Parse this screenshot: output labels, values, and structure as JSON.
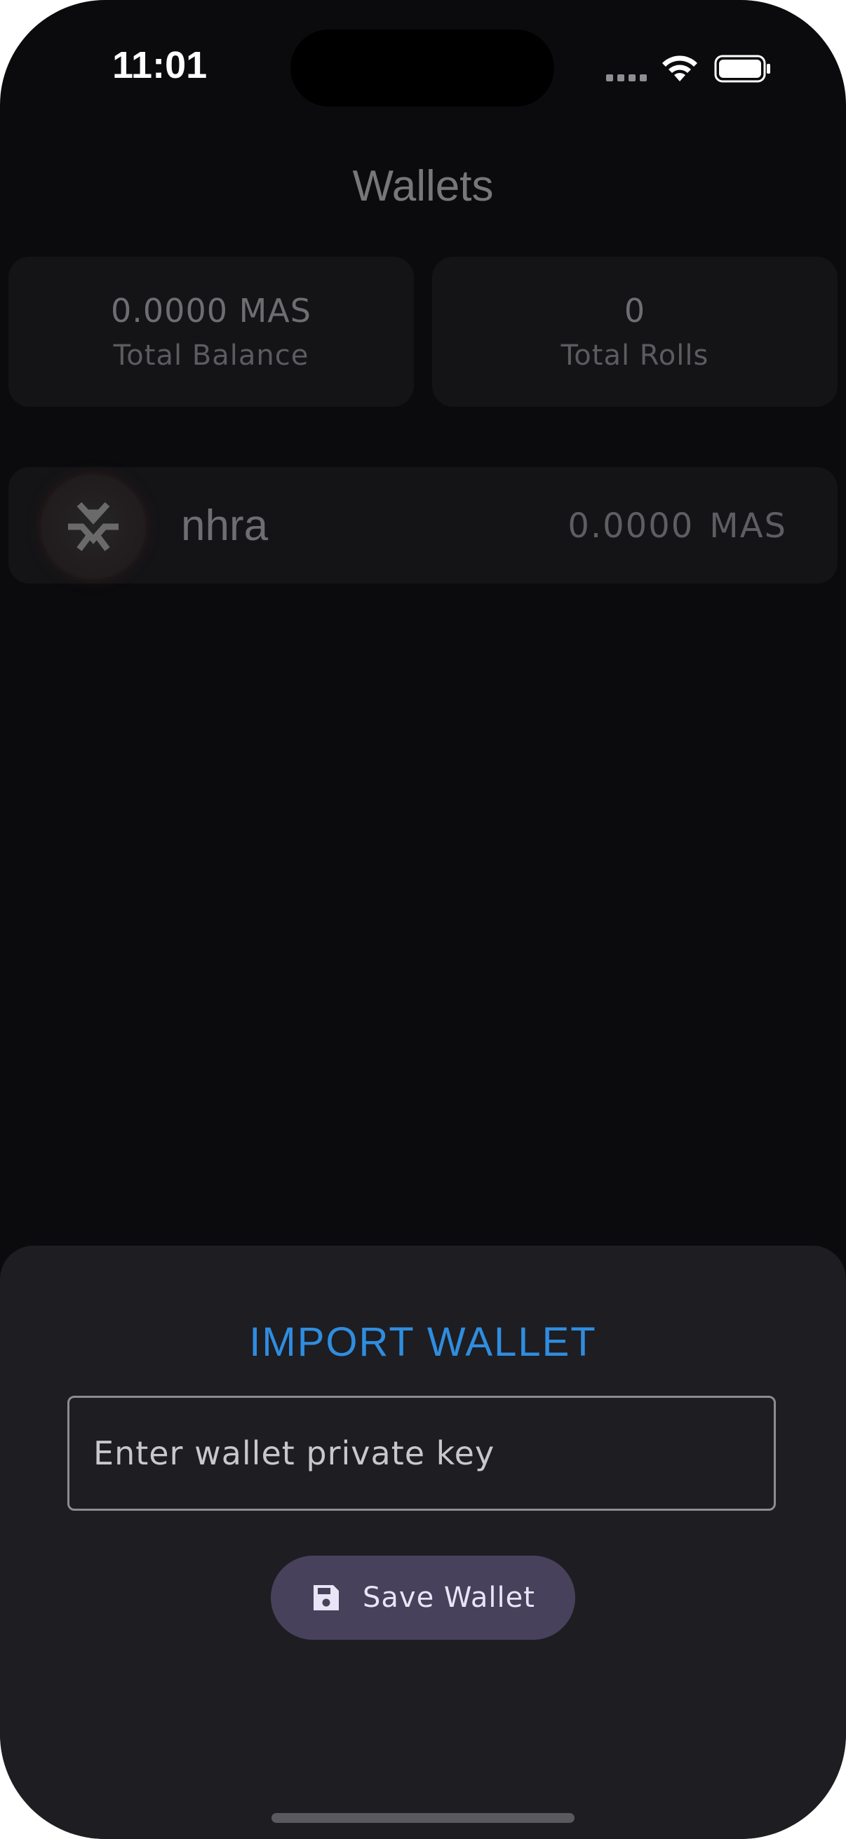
{
  "status_bar": {
    "time": "11:01",
    "icons": [
      "cellular-dots-icon",
      "wifi-icon",
      "battery-icon"
    ]
  },
  "header": {
    "title": "Wallets"
  },
  "summary": {
    "total_balance": {
      "value": "0.0000 MAS",
      "label": "Total Balance"
    },
    "total_rolls": {
      "value": "0",
      "label": "Total Rolls"
    }
  },
  "wallets": [
    {
      "name": "nhra",
      "balance": "0.0000",
      "unit": "MAS",
      "icon": "massa-logo-icon"
    }
  ],
  "import_sheet": {
    "title": "IMPORT WALLET",
    "input_placeholder": "Enter wallet private key",
    "input_value": "",
    "save_label": "Save Wallet",
    "save_icon": "floppy-disk-icon"
  },
  "colors": {
    "background": "#0b0b0d",
    "card": "#141416",
    "sheet": "#1e1d22",
    "accent": "#2f8ddf",
    "button": "#47415b"
  }
}
